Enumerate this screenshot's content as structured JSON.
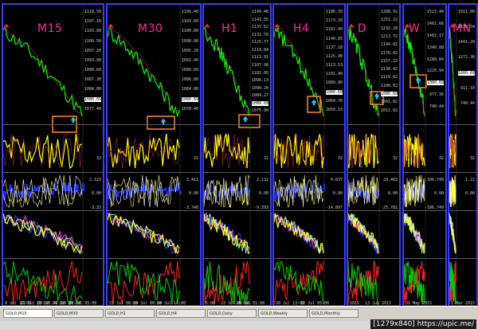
{
  "charts": [
    {
      "timeframe": "M15",
      "prices": [
        "1110.50",
        "1107.10",
        "1103.80",
        "1100.50",
        "1097.20",
        "1093.90",
        "1090.60",
        "1087.30",
        "1084.00",
        "1080.69",
        "1077.40"
      ],
      "dates": [
        "4 Jul 16:00",
        "23 Jul 00:00",
        "23 Jul 16:00",
        "24 Jul 08:00",
        "24 Jul 05:00"
      ],
      "osc_values": [
        "32",
        "2.123",
        "0.00",
        "-3.33"
      ]
    },
    {
      "timeframe": "M30",
      "prices": [
        "1106.40",
        "1103.60",
        "1100.80",
        "1098.00",
        "1095.20",
        "1092.40",
        "1089.60",
        "1086.80",
        "1084.00",
        "1080.69",
        "1078.40"
      ],
      "dates": [
        "23 Jul 06:00",
        "24 Jul 00:00",
        "24 Jul 16:00"
      ],
      "osc_values": [
        "32",
        "2.411",
        "0.00",
        "-3.740"
      ]
    },
    {
      "timeframe": "H1",
      "prices": [
        "1149.48",
        "1143.55",
        "1137.62",
        "1131.70",
        "1125.77",
        "1119.84",
        "1113.91",
        "1107.98",
        "1102.05",
        "1096.13",
        "1090.20",
        "1084.27",
        "1080.69",
        "1075.90"
      ],
      "dates": [
        "5:00",
        "23 Jul 00:00",
        "24 Jul 01:00"
      ],
      "osc_values": [
        "32",
        "2.132",
        "0.00",
        "-9.393"
      ]
    },
    {
      "timeframe": "H4",
      "prices": [
        "1186.35",
        "1173.20",
        "1161.40",
        "1149.85",
        "1137.18",
        "1125.90",
        "1113.53",
        "1101.40",
        "1089.80",
        "1080.69",
        "1064.76",
        "1050.53"
      ],
      "dates": [
        "20 Jul 13:00",
        "22 Jul 05:00"
      ],
      "osc_values": [
        "32",
        "4.637",
        "0.00",
        "-14.897"
      ]
    },
    {
      "timeframe": "D",
      "prices": [
        "1288.92",
        "1251.22",
        "1232.28",
        "1213.72",
        "1194.82",
        "1176.02",
        "1157.22",
        "1138.42",
        "1119.62",
        "1100.82",
        "1080.69",
        "1041.82",
        "1011.82"
      ],
      "dates": [
        "2015",
        "13 Jul 2015"
      ],
      "osc_values": [
        "32",
        "29.403",
        "0.00",
        "-25.781"
      ]
    },
    {
      "timeframe": "W",
      "prices": [
        "1523.44",
        "1461.66",
        "1402.17",
        "1340.88",
        "1280.84",
        "1220.94",
        "1080.69",
        "977.36",
        "740.44"
      ],
      "dates": [
        "31 May 2015"
      ],
      "osc_values": [
        "32",
        "106.749",
        "0.00",
        "-106.749"
      ]
    },
    {
      "timeframe": "MN",
      "prices": [
        "1911.00",
        "1620.54",
        "1441.20",
        "1272.30",
        "1080.69",
        "911.10",
        "740.44"
      ],
      "dates": [
        "1 Mar 2015"
      ],
      "osc_values": [
        "32",
        "1.21",
        "0.00"
      ]
    }
  ],
  "taskbar": {
    "tabs": [
      "GOLD,M15",
      "GOLD,M30",
      "GOLD,H1",
      "GOLD,H4",
      "GOLD,Daily",
      "GOLD,Weekly",
      "GOLD,Monthly"
    ],
    "active_tab": "GOLD,M15"
  },
  "watermark": "[1279x840] https://upic.me/",
  "colors": {
    "price_line": "#00ff00",
    "oscillator": "#ffff00",
    "macd": "#1a2cff",
    "adx_plus": "#ff2020",
    "adx_minus": "#00d000",
    "highlight_box": "#ff8c1a",
    "signal_arrow": "#18c8ff",
    "tf_label": "#ff2a9a"
  }
}
